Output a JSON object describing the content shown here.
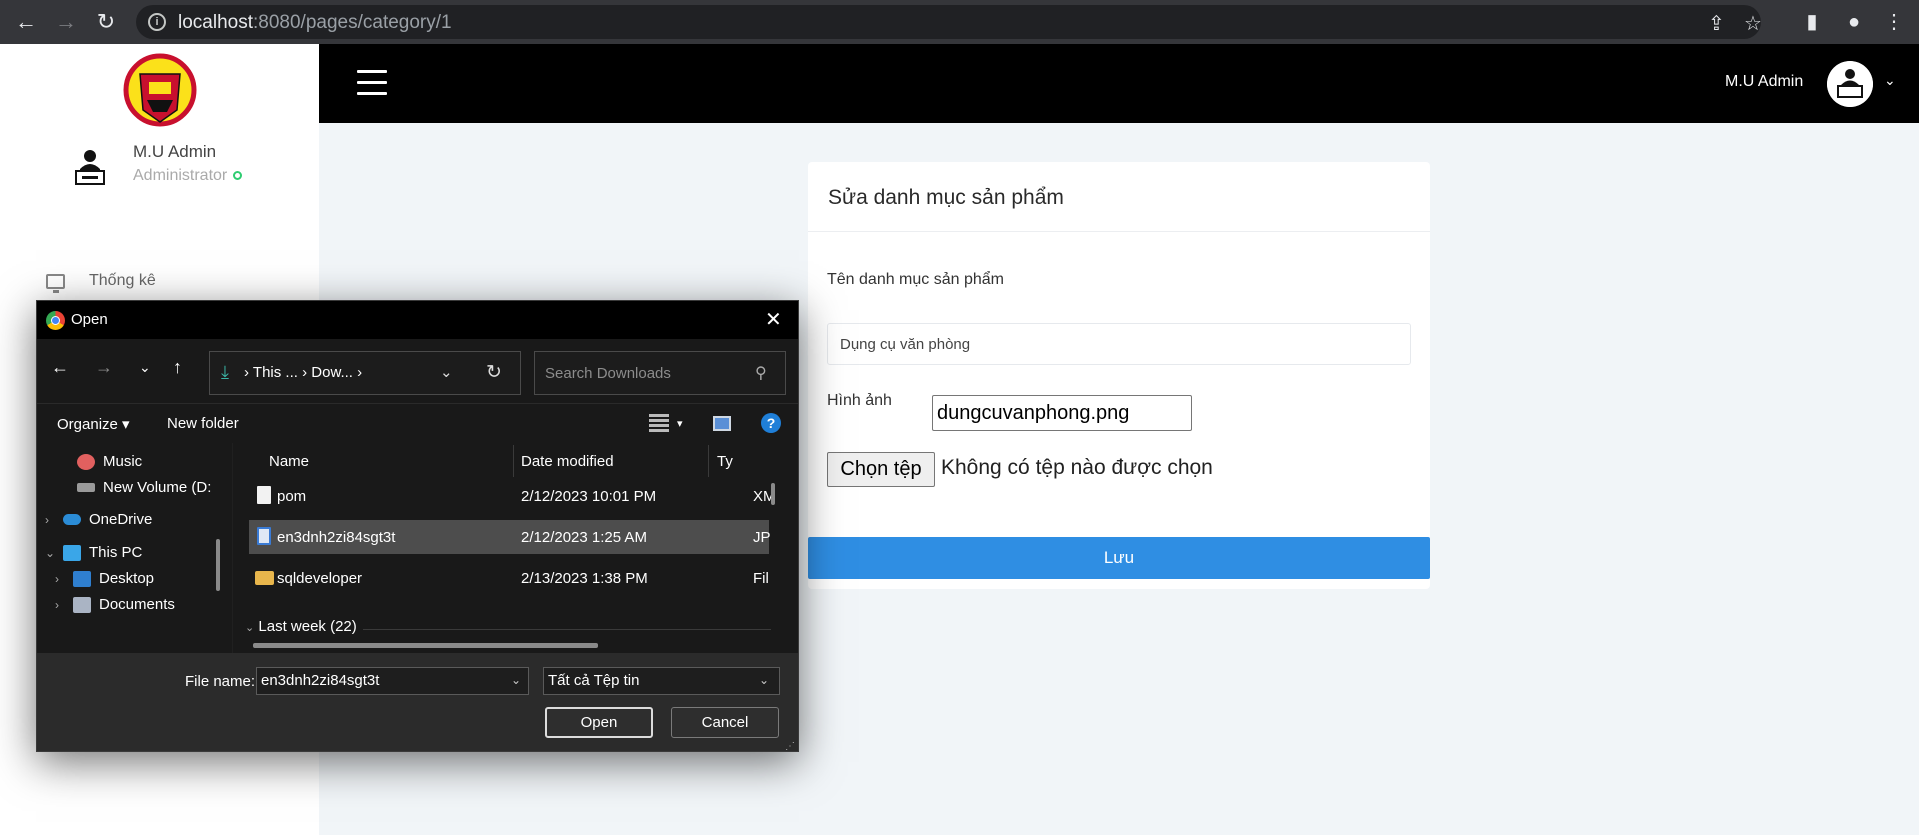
{
  "browser": {
    "url_host": "localhost",
    "url_rest": ":8080/pages/category/1"
  },
  "sidebar": {
    "user_name": "M.U Admin",
    "user_role": "Administrator",
    "menu": [
      {
        "label": "Thống kê"
      }
    ]
  },
  "header": {
    "user_name": "M.U Admin"
  },
  "form": {
    "title": "Sửa danh mục sản phẩm",
    "name_label": "Tên danh mục sản phẩm",
    "name_value": "Dụng cụ văn phòng",
    "image_label": "Hình ảnh",
    "image_value": "dungcuvanphong.png",
    "file_button": "Chọn tệp",
    "file_status": "Không có tệp nào được chọn",
    "save_button": "Lưu"
  },
  "dialog": {
    "title": "Open",
    "breadcrumb": [
      "This ...",
      "Dow..."
    ],
    "search_placeholder": "Search Downloads",
    "organize": "Organize",
    "new_folder": "New folder",
    "nav_tree": [
      {
        "label": "Music"
      },
      {
        "label": "New Volume (D:"
      },
      {
        "label": "OneDrive"
      },
      {
        "label": "This PC"
      },
      {
        "label": "Desktop"
      },
      {
        "label": "Documents"
      }
    ],
    "columns": [
      "Name",
      "Date modified",
      "Ty"
    ],
    "files": [
      {
        "name": "pom",
        "date": "2/12/2023 10:01 PM",
        "type": "XM"
      },
      {
        "name": "en3dnh2zi84sgt3t",
        "date": "2/12/2023 1:25 AM",
        "type": "JP"
      },
      {
        "name": "sqldeveloper",
        "date": "2/13/2023 1:38 PM",
        "type": "Fil"
      }
    ],
    "group_label": "Last week (22)",
    "file_name_label": "File name:",
    "file_name_value": "en3dnh2zi84sgt3t",
    "file_type": "Tất cả Tệp tin",
    "open_button": "Open",
    "cancel_button": "Cancel"
  },
  "colors": {
    "primary": "#2f8ee3",
    "header_bg": "#000000",
    "dialog_bg": "#202020"
  }
}
